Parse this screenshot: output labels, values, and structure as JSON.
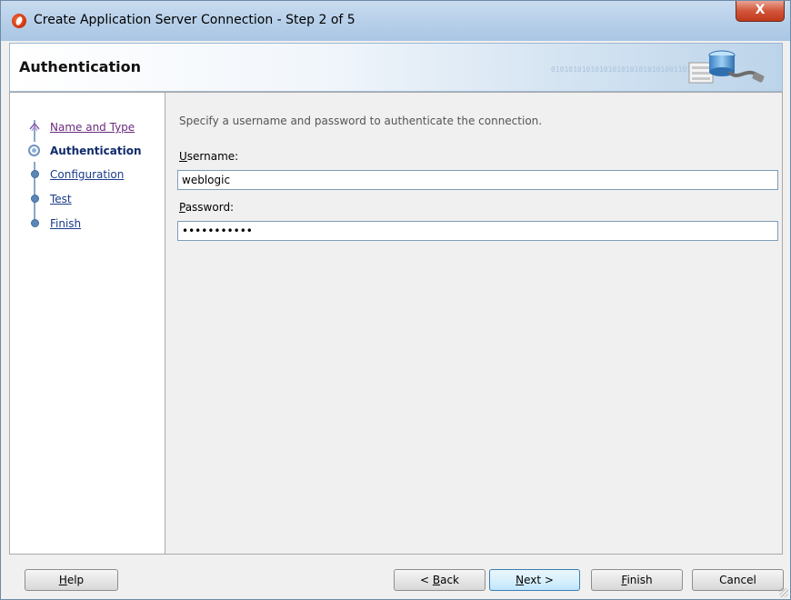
{
  "window": {
    "title": "Create Application Server Connection - Step 2 of 5",
    "close_label": "X"
  },
  "header": {
    "title": "Authentication",
    "decor_text": "01010101010101010101010101001101010"
  },
  "nav": {
    "steps": [
      {
        "label": "Name and Type",
        "state": "visited"
      },
      {
        "label": "Authentication",
        "state": "current"
      },
      {
        "label": "Configuration",
        "state": "link"
      },
      {
        "label": "Test",
        "state": "link"
      },
      {
        "label": "Finish",
        "state": "link"
      }
    ]
  },
  "form": {
    "instruction": "Specify a username and password to authenticate the connection.",
    "username": {
      "mnemonic": "U",
      "label_rest": "sername:",
      "value": "weblogic"
    },
    "password": {
      "mnemonic": "P",
      "label_rest": "assword:",
      "value": "•••••••••••"
    }
  },
  "buttons": {
    "help": {
      "mnemonic": "H",
      "rest": "elp"
    },
    "back": {
      "prefix": "< ",
      "mnemonic": "B",
      "rest": "ack"
    },
    "next": {
      "mnemonic": "N",
      "rest": "ext >"
    },
    "finish": {
      "mnemonic": "F",
      "rest": "inish"
    },
    "cancel": {
      "label": "Cancel"
    }
  },
  "colors": {
    "accent": "#1a3c8a",
    "titlebar": "#b9d1ea",
    "close": "#c0391b"
  }
}
